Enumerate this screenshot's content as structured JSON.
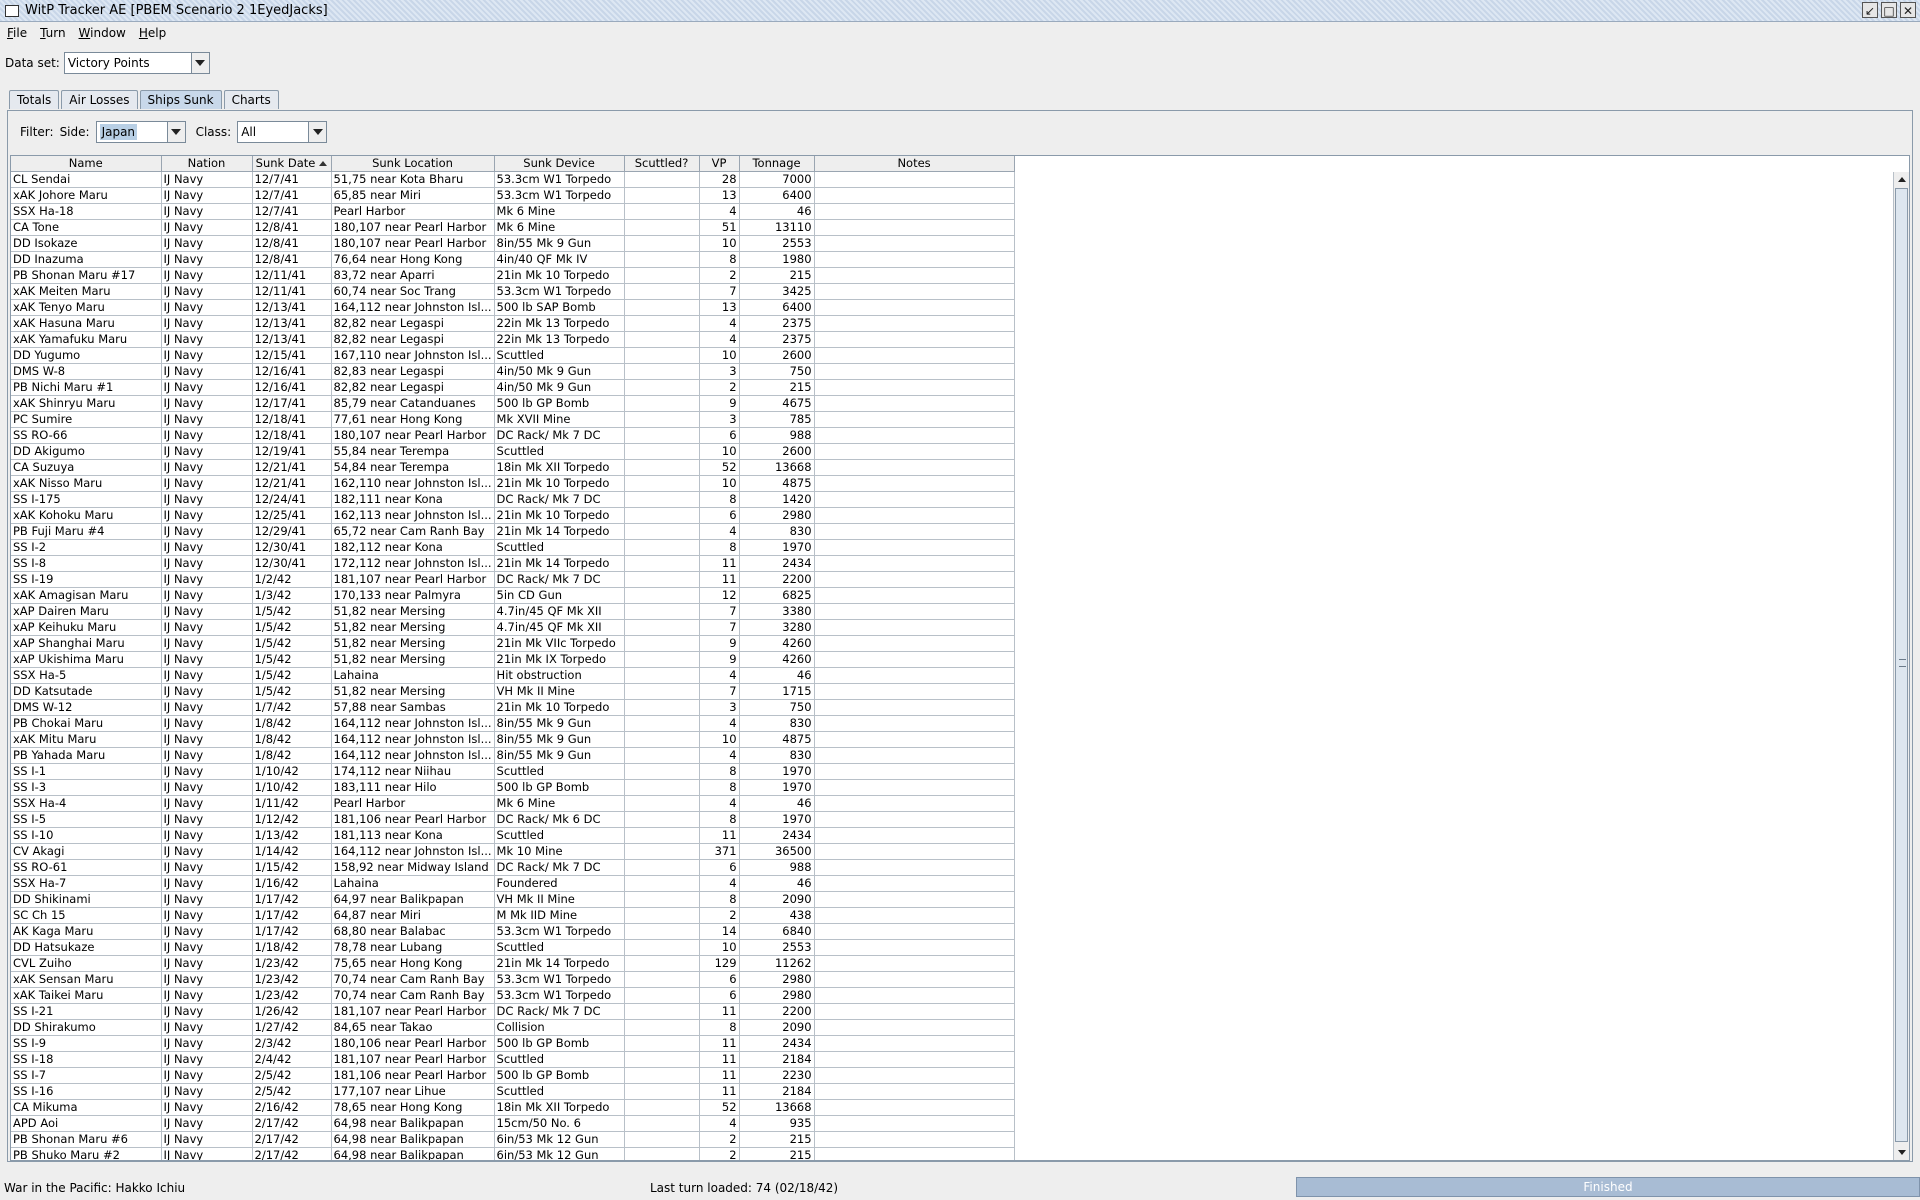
{
  "window": {
    "title": "WitP Tracker AE [PBEM Scenario 2 1EyedJacks]"
  },
  "menu": {
    "items": [
      {
        "first": "F",
        "rest": "ile"
      },
      {
        "first": "T",
        "rest": "urn"
      },
      {
        "first": "W",
        "rest": "indow"
      },
      {
        "first": "H",
        "rest": "elp"
      }
    ]
  },
  "dataset": {
    "label": "Data set:",
    "value": "Victory Points"
  },
  "tabs": [
    "Totals",
    "Air Losses",
    "Ships Sunk",
    "Charts"
  ],
  "active_tab": "Ships Sunk",
  "filter": {
    "label": "Filter:",
    "side_label": "Side:",
    "side_value": "Japan",
    "class_label": "Class:",
    "class_value": "All"
  },
  "table": {
    "columns": [
      "Name",
      "Nation",
      "Sunk Date",
      "Sunk Location",
      "Sunk Device",
      "Scuttled?",
      "VP",
      "Tonnage",
      "Notes"
    ],
    "rows": [
      [
        "CL Sendai",
        "IJ Navy",
        "12/7/41",
        "51,75 near Kota Bharu",
        "53.3cm W1 Torpedo",
        "",
        "28",
        "7000",
        ""
      ],
      [
        "xAK Johore Maru",
        "IJ Navy",
        "12/7/41",
        "65,85 near Miri",
        "53.3cm W1 Torpedo",
        "",
        "13",
        "6400",
        ""
      ],
      [
        "SSX Ha-18",
        "IJ Navy",
        "12/7/41",
        "Pearl Harbor",
        "Mk 6 Mine",
        "",
        "4",
        "46",
        ""
      ],
      [
        "CA Tone",
        "IJ Navy",
        "12/8/41",
        "180,107 near Pearl Harbor",
        "Mk 6 Mine",
        "",
        "51",
        "13110",
        ""
      ],
      [
        "DD Isokaze",
        "IJ Navy",
        "12/8/41",
        "180,107 near Pearl Harbor",
        "8in/55 Mk 9 Gun",
        "",
        "10",
        "2553",
        ""
      ],
      [
        "DD Inazuma",
        "IJ Navy",
        "12/8/41",
        "76,64 near Hong Kong",
        "4in/40 QF Mk IV",
        "",
        "8",
        "1980",
        ""
      ],
      [
        "PB Shonan Maru #17",
        "IJ Navy",
        "12/11/41",
        "83,72 near Aparri",
        "21in Mk 10 Torpedo",
        "",
        "2",
        "215",
        ""
      ],
      [
        "xAK Meiten Maru",
        "IJ Navy",
        "12/11/41",
        "60,74 near Soc Trang",
        "53.3cm W1 Torpedo",
        "",
        "7",
        "3425",
        ""
      ],
      [
        "xAK Tenyo Maru",
        "IJ Navy",
        "12/13/41",
        "164,112 near Johnston Isl...",
        "500 lb SAP Bomb",
        "",
        "13",
        "6400",
        ""
      ],
      [
        "xAK Hasuna Maru",
        "IJ Navy",
        "12/13/41",
        "82,82 near Legaspi",
        "22in Mk 13 Torpedo",
        "",
        "4",
        "2375",
        ""
      ],
      [
        "xAK Yamafuku Maru",
        "IJ Navy",
        "12/13/41",
        "82,82 near Legaspi",
        "22in Mk 13 Torpedo",
        "",
        "4",
        "2375",
        ""
      ],
      [
        "DD Yugumo",
        "IJ Navy",
        "12/15/41",
        "167,110 near Johnston Isl...",
        "Scuttled",
        "",
        "10",
        "2600",
        ""
      ],
      [
        "DMS W-8",
        "IJ Navy",
        "12/16/41",
        "82,83 near Legaspi",
        "4in/50 Mk 9 Gun",
        "",
        "3",
        "750",
        ""
      ],
      [
        "PB Nichi Maru #1",
        "IJ Navy",
        "12/16/41",
        "82,82 near Legaspi",
        "4in/50 Mk 9 Gun",
        "",
        "2",
        "215",
        ""
      ],
      [
        "xAK Shinryu Maru",
        "IJ Navy",
        "12/17/41",
        "85,79 near Catanduanes",
        "500 lb GP Bomb",
        "",
        "9",
        "4675",
        ""
      ],
      [
        "PC Sumire",
        "IJ Navy",
        "12/18/41",
        "77,61 near Hong Kong",
        "Mk XVII Mine",
        "",
        "3",
        "785",
        ""
      ],
      [
        "SS RO-66",
        "IJ Navy",
        "12/18/41",
        "180,107 near Pearl Harbor",
        "DC Rack/ Mk 7 DC",
        "",
        "6",
        "988",
        ""
      ],
      [
        "DD Akigumo",
        "IJ Navy",
        "12/19/41",
        "55,84 near Terempa",
        "Scuttled",
        "",
        "10",
        "2600",
        ""
      ],
      [
        "CA Suzuya",
        "IJ Navy",
        "12/21/41",
        "54,84 near Terempa",
        "18in Mk XII Torpedo",
        "",
        "52",
        "13668",
        ""
      ],
      [
        "xAK Nisso Maru",
        "IJ Navy",
        "12/21/41",
        "162,110 near Johnston Isl...",
        "21in Mk 10 Torpedo",
        "",
        "10",
        "4875",
        ""
      ],
      [
        "SS I-175",
        "IJ Navy",
        "12/24/41",
        "182,111 near Kona",
        "DC Rack/ Mk 7 DC",
        "",
        "8",
        "1420",
        ""
      ],
      [
        "xAK Kohoku Maru",
        "IJ Navy",
        "12/25/41",
        "162,113 near Johnston Isl...",
        "21in Mk 10 Torpedo",
        "",
        "6",
        "2980",
        ""
      ],
      [
        "PB Fuji Maru #4",
        "IJ Navy",
        "12/29/41",
        "65,72 near Cam Ranh Bay",
        "21in Mk 14 Torpedo",
        "",
        "4",
        "830",
        ""
      ],
      [
        "SS I-2",
        "IJ Navy",
        "12/30/41",
        "182,112 near Kona",
        "Scuttled",
        "",
        "8",
        "1970",
        ""
      ],
      [
        "SS I-8",
        "IJ Navy",
        "12/30/41",
        "172,112 near Johnston Isl...",
        "21in Mk 14 Torpedo",
        "",
        "11",
        "2434",
        ""
      ],
      [
        "SS I-19",
        "IJ Navy",
        "1/2/42",
        "181,107 near Pearl Harbor",
        "DC Rack/ Mk 7 DC",
        "",
        "11",
        "2200",
        ""
      ],
      [
        "xAK Amagisan Maru",
        "IJ Navy",
        "1/3/42",
        "170,133 near Palmyra",
        "5in CD Gun",
        "",
        "12",
        "6825",
        ""
      ],
      [
        "xAP Dairen Maru",
        "IJ Navy",
        "1/5/42",
        "51,82 near Mersing",
        "4.7in/45 QF Mk XII",
        "",
        "7",
        "3380",
        ""
      ],
      [
        "xAP Keihuku Maru",
        "IJ Navy",
        "1/5/42",
        "51,82 near Mersing",
        "4.7in/45 QF Mk XII",
        "",
        "7",
        "3280",
        ""
      ],
      [
        "xAP Shanghai Maru",
        "IJ Navy",
        "1/5/42",
        "51,82 near Mersing",
        "21in Mk VIIc Torpedo",
        "",
        "9",
        "4260",
        ""
      ],
      [
        "xAP Ukishima Maru",
        "IJ Navy",
        "1/5/42",
        "51,82 near Mersing",
        "21in Mk IX Torpedo",
        "",
        "9",
        "4260",
        ""
      ],
      [
        "SSX Ha-5",
        "IJ Navy",
        "1/5/42",
        "Lahaina",
        "Hit obstruction",
        "",
        "4",
        "46",
        ""
      ],
      [
        "DD Katsutade",
        "IJ Navy",
        "1/5/42",
        "51,82 near Mersing",
        "VH Mk II Mine",
        "",
        "7",
        "1715",
        ""
      ],
      [
        "DMS W-12",
        "IJ Navy",
        "1/7/42",
        "57,88 near Sambas",
        "21in Mk 10 Torpedo",
        "",
        "3",
        "750",
        ""
      ],
      [
        "PB Chokai Maru",
        "IJ Navy",
        "1/8/42",
        "164,112 near Johnston Isl...",
        "8in/55 Mk 9 Gun",
        "",
        "4",
        "830",
        ""
      ],
      [
        "xAK Mitu Maru",
        "IJ Navy",
        "1/8/42",
        "164,112 near Johnston Isl...",
        "8in/55 Mk 9 Gun",
        "",
        "10",
        "4875",
        ""
      ],
      [
        "PB Yahada Maru",
        "IJ Navy",
        "1/8/42",
        "164,112 near Johnston Isl...",
        "8in/55 Mk 9 Gun",
        "",
        "4",
        "830",
        ""
      ],
      [
        "SS I-1",
        "IJ Navy",
        "1/10/42",
        "174,112 near Niihau",
        "Scuttled",
        "",
        "8",
        "1970",
        ""
      ],
      [
        "SS I-3",
        "IJ Navy",
        "1/10/42",
        "183,111 near Hilo",
        "500 lb GP Bomb",
        "",
        "8",
        "1970",
        ""
      ],
      [
        "SSX Ha-4",
        "IJ Navy",
        "1/11/42",
        "Pearl Harbor",
        "Mk 6 Mine",
        "",
        "4",
        "46",
        ""
      ],
      [
        "SS I-5",
        "IJ Navy",
        "1/12/42",
        "181,106 near Pearl Harbor",
        "DC Rack/ Mk 6 DC",
        "",
        "8",
        "1970",
        ""
      ],
      [
        "SS I-10",
        "IJ Navy",
        "1/13/42",
        "181,113 near Kona",
        "Scuttled",
        "",
        "11",
        "2434",
        ""
      ],
      [
        "CV Akagi",
        "IJ Navy",
        "1/14/42",
        "164,112 near Johnston Isl...",
        "Mk 10 Mine",
        "",
        "371",
        "36500",
        ""
      ],
      [
        "SS RO-61",
        "IJ Navy",
        "1/15/42",
        "158,92 near Midway Island",
        "DC Rack/ Mk 7 DC",
        "",
        "6",
        "988",
        ""
      ],
      [
        "SSX Ha-7",
        "IJ Navy",
        "1/16/42",
        "Lahaina",
        "Foundered",
        "",
        "4",
        "46",
        ""
      ],
      [
        "DD Shikinami",
        "IJ Navy",
        "1/17/42",
        "64,97 near Balikpapan",
        "VH Mk II Mine",
        "",
        "8",
        "2090",
        ""
      ],
      [
        "SC Ch 15",
        "IJ Navy",
        "1/17/42",
        "64,87 near Miri",
        "M Mk IID Mine",
        "",
        "2",
        "438",
        ""
      ],
      [
        "AK Kaga Maru",
        "IJ Navy",
        "1/17/42",
        "68,80 near Balabac",
        "53.3cm W1 Torpedo",
        "",
        "14",
        "6840",
        ""
      ],
      [
        "DD Hatsukaze",
        "IJ Navy",
        "1/18/42",
        "78,78 near Lubang",
        "Scuttled",
        "",
        "10",
        "2553",
        ""
      ],
      [
        "CVL Zuiho",
        "IJ Navy",
        "1/23/42",
        "75,65 near Hong Kong",
        "21in Mk 14 Torpedo",
        "",
        "129",
        "11262",
        ""
      ],
      [
        "xAK Sensan Maru",
        "IJ Navy",
        "1/23/42",
        "70,74 near Cam Ranh Bay",
        "53.3cm W1 Torpedo",
        "",
        "6",
        "2980",
        ""
      ],
      [
        "xAK Taikei Maru",
        "IJ Navy",
        "1/23/42",
        "70,74 near Cam Ranh Bay",
        "53.3cm W1 Torpedo",
        "",
        "6",
        "2980",
        ""
      ],
      [
        "SS I-21",
        "IJ Navy",
        "1/26/42",
        "181,107 near Pearl Harbor",
        "DC Rack/ Mk 7 DC",
        "",
        "11",
        "2200",
        ""
      ],
      [
        "DD Shirakumo",
        "IJ Navy",
        "1/27/42",
        "84,65 near Takao",
        "Collision",
        "",
        "8",
        "2090",
        ""
      ],
      [
        "SS I-9",
        "IJ Navy",
        "2/3/42",
        "180,106 near Pearl Harbor",
        "500 lb GP Bomb",
        "",
        "11",
        "2434",
        ""
      ],
      [
        "SS I-18",
        "IJ Navy",
        "2/4/42",
        "181,107 near Pearl Harbor",
        "Scuttled",
        "",
        "11",
        "2184",
        ""
      ],
      [
        "SS I-7",
        "IJ Navy",
        "2/5/42",
        "181,106 near Pearl Harbor",
        "500 lb GP Bomb",
        "",
        "11",
        "2230",
        ""
      ],
      [
        "SS I-16",
        "IJ Navy",
        "2/5/42",
        "177,107 near Lihue",
        "Scuttled",
        "",
        "11",
        "2184",
        ""
      ],
      [
        "CA Mikuma",
        "IJ Navy",
        "2/16/42",
        "78,65 near Hong Kong",
        "18in Mk XII Torpedo",
        "",
        "52",
        "13668",
        ""
      ],
      [
        "APD Aoi",
        "IJ Navy",
        "2/17/42",
        "64,98 near Balikpapan",
        "15cm/50 No. 6",
        "",
        "4",
        "935",
        ""
      ],
      [
        "PB Shonan Maru #6",
        "IJ Navy",
        "2/17/42",
        "64,98 near Balikpapan",
        "6in/53 Mk 12 Gun",
        "",
        "2",
        "215",
        ""
      ],
      [
        "PB Shuko Maru #2",
        "IJ Navy",
        "2/17/42",
        "64,98 near Balikpapan",
        "6in/53 Mk 12 Gun",
        "",
        "2",
        "215",
        ""
      ]
    ]
  },
  "status": {
    "left": "War in the Pacific: Hakko Ichiu",
    "middle": "Last turn loaded: 74 (02/18/42)",
    "progress_label": "Finished",
    "progress": 1.0
  },
  "colors": {
    "selected_tab": "#c8d8ea",
    "progress_fill": "#a8bcd4",
    "combo_selection": "#b8cfe5"
  },
  "icons": {
    "minimize": "minimize-icon",
    "maximize": "maximize-icon",
    "close": "close-icon",
    "sort_ascending": "sort-ascending-icon"
  }
}
